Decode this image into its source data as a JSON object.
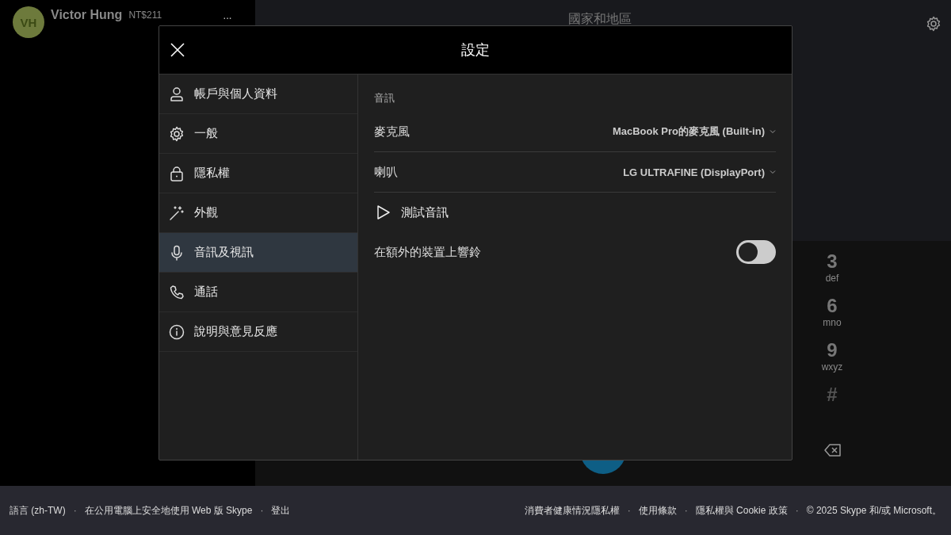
{
  "profile": {
    "initials": "VH",
    "name": "Victor Hung",
    "credit": "NT$211",
    "more": "···"
  },
  "country_selector": {
    "label": "國家和地區"
  },
  "dialpad": {
    "keys": [
      {
        "digit": "3",
        "letters": "def"
      },
      {
        "digit": "6",
        "letters": "mno"
      },
      {
        "digit": "9",
        "letters": "wxyz"
      },
      {
        "digit": "#"
      }
    ]
  },
  "dialog": {
    "title": "設定",
    "sidebar": {
      "items": [
        {
          "label": "帳戶與個人資料",
          "selected": false
        },
        {
          "label": "一般",
          "selected": false
        },
        {
          "label": "隱私權",
          "selected": false
        },
        {
          "label": "外觀",
          "selected": false
        },
        {
          "label": "音訊及視訊",
          "selected": true
        },
        {
          "label": "通話",
          "selected": false
        },
        {
          "label": "說明與意見反應",
          "selected": false
        }
      ]
    },
    "content": {
      "section": "音訊",
      "rows": [
        {
          "kind": "select",
          "label": "麥克風",
          "value": "MacBook Pro的麥克風 (Built-in)"
        },
        {
          "kind": "select",
          "label": "喇叭",
          "value": "LG ULTRAFINE (DisplayPort)"
        },
        {
          "kind": "action",
          "label": "測試音訊"
        },
        {
          "kind": "toggle",
          "label": "在額外的裝置上響鈴",
          "on": false
        }
      ]
    }
  },
  "footer": {
    "left": [
      {
        "kind": "link",
        "text": "語言 (zh-TW)"
      },
      {
        "kind": "separator",
        "text": "·"
      },
      {
        "kind": "link",
        "text": "在公用電腦上安全地使用 Web 版 Skype"
      },
      {
        "kind": "separator",
        "text": "·"
      },
      {
        "kind": "link",
        "text": "登出"
      }
    ],
    "right": [
      {
        "kind": "link",
        "text": "消費者健康情況隱私權"
      },
      {
        "kind": "separator",
        "text": "·"
      },
      {
        "kind": "link",
        "text": "使用條款"
      },
      {
        "kind": "separator",
        "text": "·"
      },
      {
        "kind": "link",
        "text": "隱私權與 Cookie 政策"
      },
      {
        "kind": "separator",
        "text": "·"
      },
      {
        "kind": "text",
        "text": "© 2025 Skype 和/或 Microsoft。"
      }
    ]
  }
}
